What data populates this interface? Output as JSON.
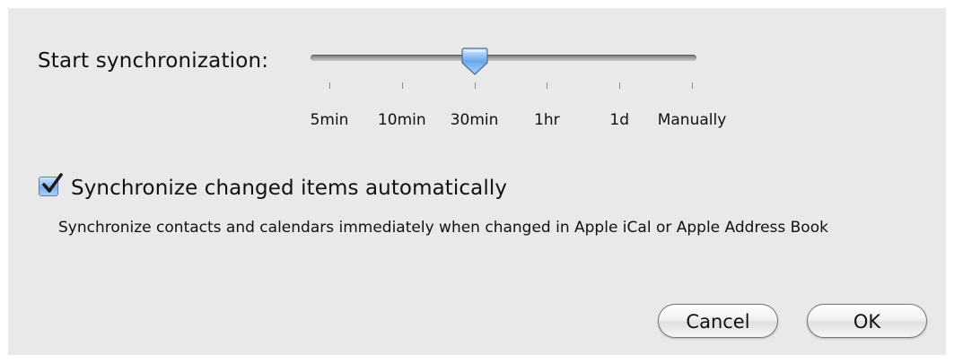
{
  "sync": {
    "label": "Start synchronization:",
    "options": [
      "5min",
      "10min",
      "30min",
      "1hr",
      "1d",
      "Manually"
    ],
    "selected_index": 2,
    "selected_value": "30min"
  },
  "auto_sync": {
    "checked": true,
    "label": "Synchronize changed items automatically",
    "description": "Synchronize contacts and calendars immediately when changed in Apple iCal or Apple Address Book"
  },
  "buttons": {
    "cancel": "Cancel",
    "ok": "OK"
  },
  "colors": {
    "panel_background": "#e9e9e9",
    "accent_blue": "#5b9ee6"
  },
  "icons": {
    "slider_thumb": "slider-thumb-icon",
    "checkmark": "checkmark-icon"
  }
}
